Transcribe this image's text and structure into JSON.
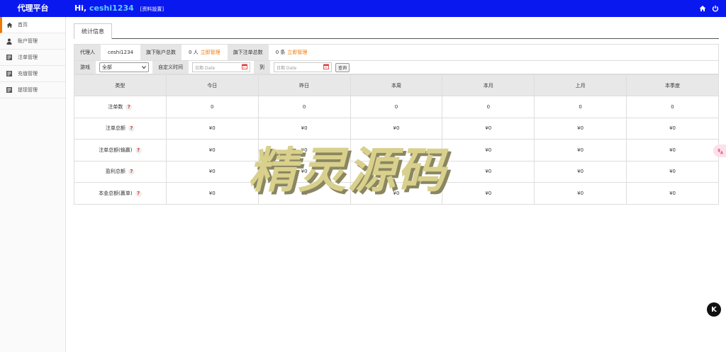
{
  "header": {
    "brand": "代理平台",
    "greeting_prefix": "Hi,",
    "username": "ceshi1234",
    "profile_link": "[资料設置]",
    "bg_color": "#0a18f0"
  },
  "sidebar": {
    "items": [
      {
        "label": "首页",
        "icon": "home-icon",
        "active": true
      },
      {
        "label": "账户管理",
        "icon": "user-icon"
      },
      {
        "label": "注单管理",
        "icon": "list-icon"
      },
      {
        "label": "充值管理",
        "icon": "list-icon"
      },
      {
        "label": "提现管理",
        "icon": "list-icon"
      }
    ]
  },
  "main": {
    "tab": "统计信息",
    "info": {
      "agent_label": "代理人",
      "agent_value": "ceshi1234",
      "accounts_label": "旗下账户总数",
      "accounts_value": "0 人",
      "accounts_link": "立即管理",
      "bets_label": "旗下注单总数",
      "bets_value": "0 条",
      "bets_link": "立即管理"
    },
    "filter": {
      "game_label": "游戏",
      "game_selected": "全部",
      "custom_time_label": "自定义时间",
      "date_placeholder": "日期 Date",
      "to_label": "到",
      "search_button": "查询"
    },
    "table": {
      "headers": [
        "类型",
        "今日",
        "昨日",
        "本周",
        "本月",
        "上月",
        "本季度"
      ],
      "rows": [
        {
          "type": "注单数",
          "values": [
            "0",
            "0",
            "0",
            "0",
            "0",
            "0"
          ]
        },
        {
          "type": "注单总额",
          "values": [
            "¥0",
            "¥0",
            "¥0",
            "¥0",
            "¥0",
            "¥0"
          ]
        },
        {
          "type": "注单总额(输赢)",
          "values": [
            "¥0",
            "¥0",
            "¥0",
            "¥0",
            "¥0",
            "¥0"
          ]
        },
        {
          "type": "盈利总额",
          "values": [
            "¥0",
            "¥0",
            "¥0",
            "¥0",
            "¥0",
            "¥0"
          ]
        },
        {
          "type": "本金总额(赢单)",
          "values": [
            "¥0",
            "¥0",
            "¥0",
            "¥0",
            "¥0",
            "¥0"
          ]
        }
      ]
    }
  },
  "watermark": "精灵源码",
  "help_mark": "?",
  "float_k": "K"
}
